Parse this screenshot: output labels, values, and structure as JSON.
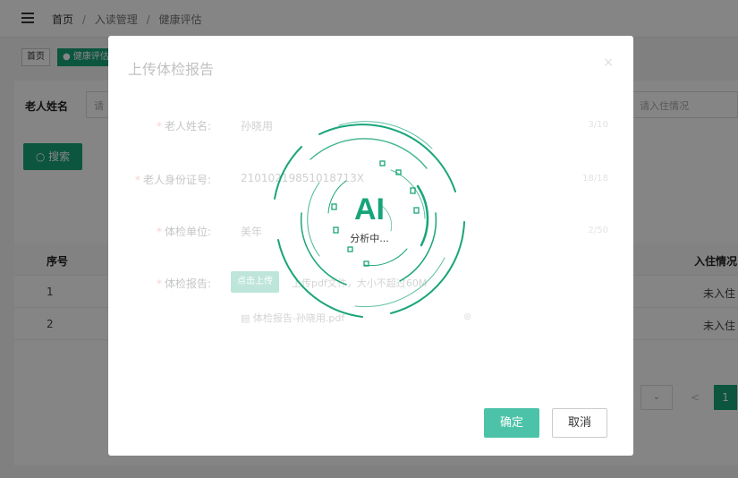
{
  "header": {
    "breadcrumb": [
      "首页",
      "入读管理",
      "健康评估"
    ],
    "separator": "/"
  },
  "tabs": [
    {
      "label": "首页",
      "active": false
    },
    {
      "label": "● 健康评估",
      "active": true
    }
  ],
  "filters": {
    "elder_name_label": "老人姓名",
    "elder_name_placeholder": "请",
    "checkin_placeholder": "请入住情况",
    "search_label": "○ 搜索"
  },
  "table": {
    "columns": [
      "序号",
      "",
      "入住情况"
    ],
    "rows": [
      {
        "index": "1",
        "status": "未入住"
      },
      {
        "index": "2",
        "status": "未入住"
      }
    ]
  },
  "pagination": {
    "page_size_icon": "chevron-down-icon",
    "prev": "<",
    "current": "1"
  },
  "modal": {
    "title": "上传体检报告",
    "close": "×",
    "fields": {
      "name_label": "老人姓名:",
      "name_value": "孙晓用",
      "name_count": "3/10",
      "id_label": "老人身份证号:",
      "id_value": "21010219851018713X",
      "id_count": "18/18",
      "org_label": "体检单位:",
      "org_value": "美年",
      "org_count": "2/50",
      "report_label": "体检报告:",
      "upload_button": "点击上传",
      "upload_hint": "上传pdf文件，大小不超过60M",
      "file_name": "体检报告-孙晓用.pdf"
    },
    "ai": {
      "title": "AI",
      "subtitle": "分析中..."
    },
    "confirm": "确定",
    "cancel": "取消"
  },
  "colors": {
    "brand": "#18a47a",
    "ai_accent": "#16a57a",
    "confirm": "#4cc3a8"
  }
}
